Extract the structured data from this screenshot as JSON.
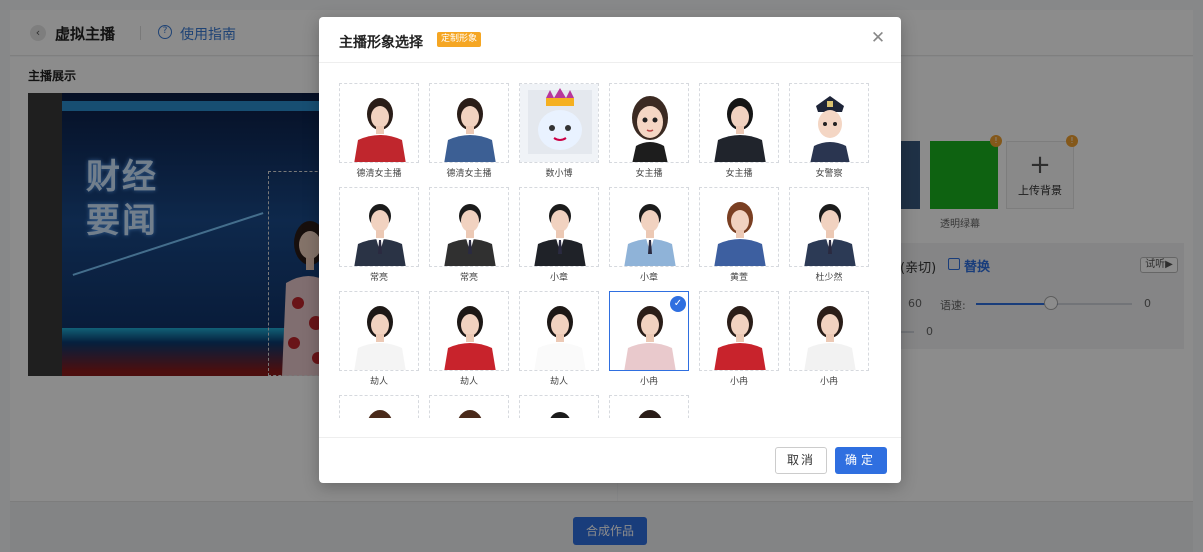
{
  "header": {
    "back_icon": "chevron-left-icon",
    "title": "虚拟主播",
    "help_icon": "question-circle-icon",
    "help_label": "使用指南"
  },
  "preview": {
    "label": "主播展示",
    "news_text_line1": "财经",
    "news_text_line2": "要闻"
  },
  "background": {
    "green_label": "透明绿幕",
    "upload_label": "上传背景",
    "upload_icon": "plus-icon",
    "badge_text": "!",
    "green_color": "#1bb21f"
  },
  "voice": {
    "name": "(亲切)",
    "replace_label": "替换",
    "replace_icon": "swap-icon",
    "try_label": "试听▶",
    "volume_value": "60",
    "speed_label": "语速:",
    "speed_value": "0",
    "speed_level": 0.47,
    "pitch_value": "0"
  },
  "footer": {
    "submit_label": "合成作品"
  },
  "modal": {
    "title": "主播形象选择",
    "tag": "定制形象",
    "close_icon": "close-icon",
    "cancel_label": "取消",
    "ok_label": "确定",
    "check_icon": "checkmark-icon",
    "accent": "#2f6fe0",
    "tag_color": "#f5a623",
    "avatars": [
      {
        "label": "德清女主播",
        "kind": "woman",
        "outfit": "#c0262d",
        "hair": "#2a1d18",
        "selected": false
      },
      {
        "label": "德清女主播",
        "kind": "woman",
        "outfit": "#3c5f94",
        "hair": "#2a1d18",
        "selected": false
      },
      {
        "label": "数小博",
        "kind": "robot",
        "outfit": "#e9f2ff",
        "hair": "#b8379a",
        "selected": false
      },
      {
        "label": "女主播",
        "kind": "cartoon",
        "outfit": "#1d1d1d",
        "hair": "#3b2a22",
        "selected": false
      },
      {
        "label": "女主播",
        "kind": "woman",
        "outfit": "#20242c",
        "hair": "#151515",
        "selected": false
      },
      {
        "label": "女警察",
        "kind": "police",
        "outfit": "#2a3550",
        "hair": "#1d2438",
        "selected": false
      },
      {
        "label": "常亮",
        "kind": "man",
        "outfit": "#2a3345",
        "hair": "#1b1b1b",
        "selected": false
      },
      {
        "label": "常亮",
        "kind": "man",
        "outfit": "#303030",
        "hair": "#1b1b1b",
        "selected": false
      },
      {
        "label": "小章",
        "kind": "man",
        "outfit": "#1f2228",
        "hair": "#1b1b1b",
        "selected": false
      },
      {
        "label": "小章",
        "kind": "man",
        "outfit": "#8fb3d8",
        "hair": "#1b1b1b",
        "selected": false
      },
      {
        "label": "黄萱",
        "kind": "woman",
        "outfit": "#3d5fa0",
        "hair": "#7a3f22",
        "selected": false
      },
      {
        "label": "杜少然",
        "kind": "man",
        "outfit": "#2c3a55",
        "hair": "#1b1b1b",
        "selected": false
      },
      {
        "label": "劫人",
        "kind": "woman",
        "outfit": "#f4f4f4",
        "hair": "#1d1816",
        "selected": false
      },
      {
        "label": "劫人",
        "kind": "woman",
        "outfit": "#c8232c",
        "hair": "#1d1816",
        "selected": false
      },
      {
        "label": "劫人",
        "kind": "woman",
        "outfit": "#fafafa",
        "hair": "#1d1816",
        "selected": false
      },
      {
        "label": "小冉",
        "kind": "woman",
        "outfit": "#e9c9cc",
        "hair": "#2a1d18",
        "selected": true
      },
      {
        "label": "小冉",
        "kind": "woman",
        "outfit": "#c8232c",
        "hair": "#2a1d18",
        "selected": false
      },
      {
        "label": "小冉",
        "kind": "woman",
        "outfit": "#f2f2f2",
        "hair": "#2a1d18",
        "selected": false
      },
      {
        "label": "",
        "kind": "woman",
        "outfit": "#b0b0b0",
        "hair": "#4a2a1a",
        "selected": false
      },
      {
        "label": "",
        "kind": "woman",
        "outfit": "#b0b0b0",
        "hair": "#4a2a1a",
        "selected": false
      },
      {
        "label": "",
        "kind": "man",
        "outfit": "#b0b0b0",
        "hair": "#1b1b1b",
        "selected": false
      },
      {
        "label": "",
        "kind": "woman",
        "outfit": "#b0b0b0",
        "hair": "#2a1d18",
        "selected": false
      }
    ]
  }
}
